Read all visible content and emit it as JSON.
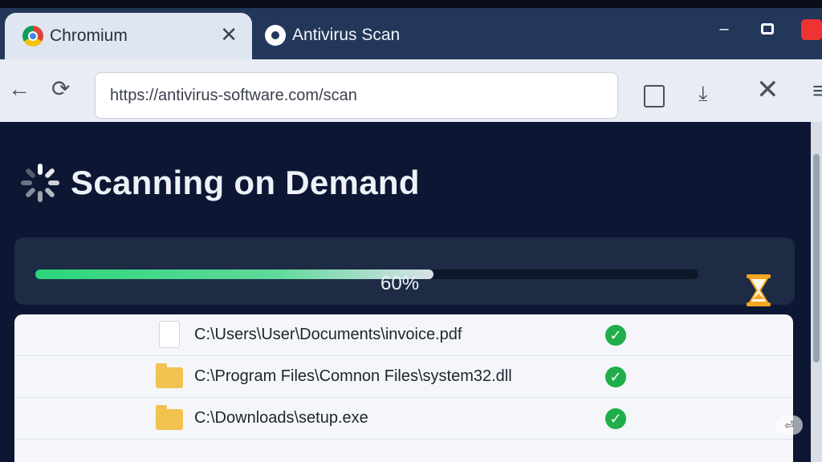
{
  "tabs": [
    {
      "label": "Chromium",
      "close_glyph": "✕",
      "icon": "chromium-logo-icon"
    },
    {
      "label": "Antivirus Scan",
      "icon": "antivirus-logo-icon"
    }
  ],
  "window_controls": {
    "minimize": "–",
    "close": ""
  },
  "toolbar": {
    "back_glyph": "←",
    "reload_glyph": "⟳",
    "url": "https://antivirus-software.com/scan",
    "download_glyph": "⤓",
    "stop_glyph": "✕",
    "menu_glyph": "≡"
  },
  "page": {
    "title": "Scanning on Demand",
    "progress": {
      "percent": 60,
      "label": "60%"
    },
    "files": [
      {
        "path": "C:\\Users\\User\\Documents\\invoice.pdf",
        "type": "document",
        "status": "clean"
      },
      {
        "path": "C:\\Program Files\\Comnon Files\\system32.dll",
        "type": "folder",
        "status": "clean"
      },
      {
        "path": "C:\\Downloads\\setup.exe",
        "type": "folder",
        "status": "clean"
      }
    ],
    "check_glyph": "✓"
  },
  "colors": {
    "accent_green": "#2bd67b",
    "page_background": "#0d1733",
    "titlebar": "#22375a",
    "hourglass": "#f5a623"
  }
}
